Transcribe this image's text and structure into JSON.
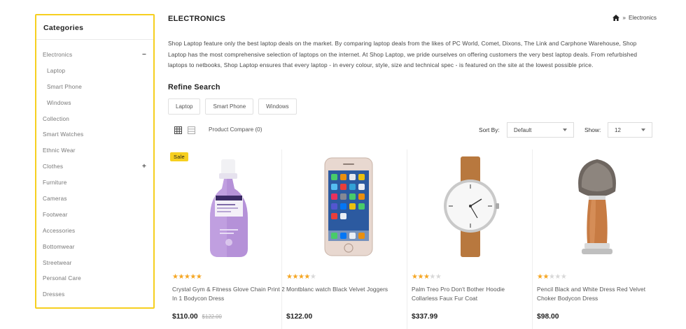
{
  "sidebar": {
    "title": "Categories",
    "items": [
      {
        "label": "Electronics",
        "toggle": "−"
      },
      {
        "label": "Laptop"
      },
      {
        "label": "Smart Phone"
      },
      {
        "label": "Windows"
      },
      {
        "label": "Collection"
      },
      {
        "label": "Smart Watches"
      },
      {
        "label": "Ethnic Wear"
      },
      {
        "label": "Clothes",
        "toggle": "+"
      },
      {
        "label": "Furniture"
      },
      {
        "label": "Cameras"
      },
      {
        "label": "Footwear"
      },
      {
        "label": "Accessories"
      },
      {
        "label": "Bottomwear"
      },
      {
        "label": "Streetwear"
      },
      {
        "label": "Personal Care"
      },
      {
        "label": "Dresses"
      }
    ]
  },
  "page": {
    "title": "ELECTRONICS",
    "breadcrumb_separator": "»",
    "breadcrumb_current": "Electronics",
    "description": "Shop Laptop feature only the best laptop deals on the market. By comparing laptop deals from the likes of PC World, Comet, Dixons, The Link and Carphone Warehouse, Shop Laptop has the most comprehensive selection of laptops on the internet. At Shop Laptop, we pride ourselves on offering customers the very best laptop deals. From refurbished laptops to netbooks, Shop Laptop ensures that every laptop - in every colour, style, size and technical spec - is featured on the site at the lowest possible price."
  },
  "refine": {
    "title": "Refine Search",
    "tags": [
      "Laptop",
      "Smart Phone",
      "Windows"
    ]
  },
  "toolbar": {
    "compare": "Product Compare (0)",
    "sort_label": "Sort By:",
    "sort_value": "Default",
    "show_label": "Show:",
    "show_value": "12"
  },
  "products": [
    {
      "name": "Crystal Gym & Fitness Glove Chain Print 2 In 1 Bodycon Dress",
      "price": "$110.00",
      "old_price": "$122.00",
      "rating": 5,
      "badge": "Sale"
    },
    {
      "name": "Montblanc watch Black Velvet Joggers",
      "price": "$122.00",
      "rating": 4
    },
    {
      "name": "Palm Treo Pro Don't Bother Hoodie Collarless Faux Fur Coat",
      "price": "$337.99",
      "rating": 3
    },
    {
      "name": "Pencil Black and White Dress Red Velvet Choker Bodycon Dress",
      "price": "$98.00",
      "rating": 2
    }
  ],
  "colors": {
    "accent": "#f6cf1f",
    "star": "#f5a623"
  }
}
